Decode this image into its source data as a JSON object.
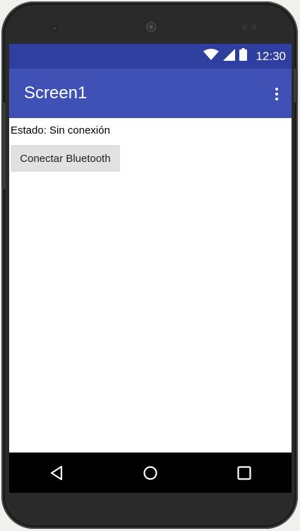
{
  "status_bar": {
    "time": "12:30",
    "icons": [
      "wifi-icon",
      "signal-icon",
      "battery-icon"
    ]
  },
  "app_bar": {
    "title": "Screen1",
    "overflow_icon": "more-vert-icon"
  },
  "content": {
    "status_label": "Estado: Sin conexión",
    "connect_button_label": "Conectar Bluetooth"
  },
  "nav_bar": {
    "buttons": [
      "back-icon",
      "home-icon",
      "recents-icon"
    ]
  },
  "colors": {
    "status_bar": "#2f3f9f",
    "app_bar": "#3f51b5",
    "button_bg": "#e1e1e1"
  }
}
